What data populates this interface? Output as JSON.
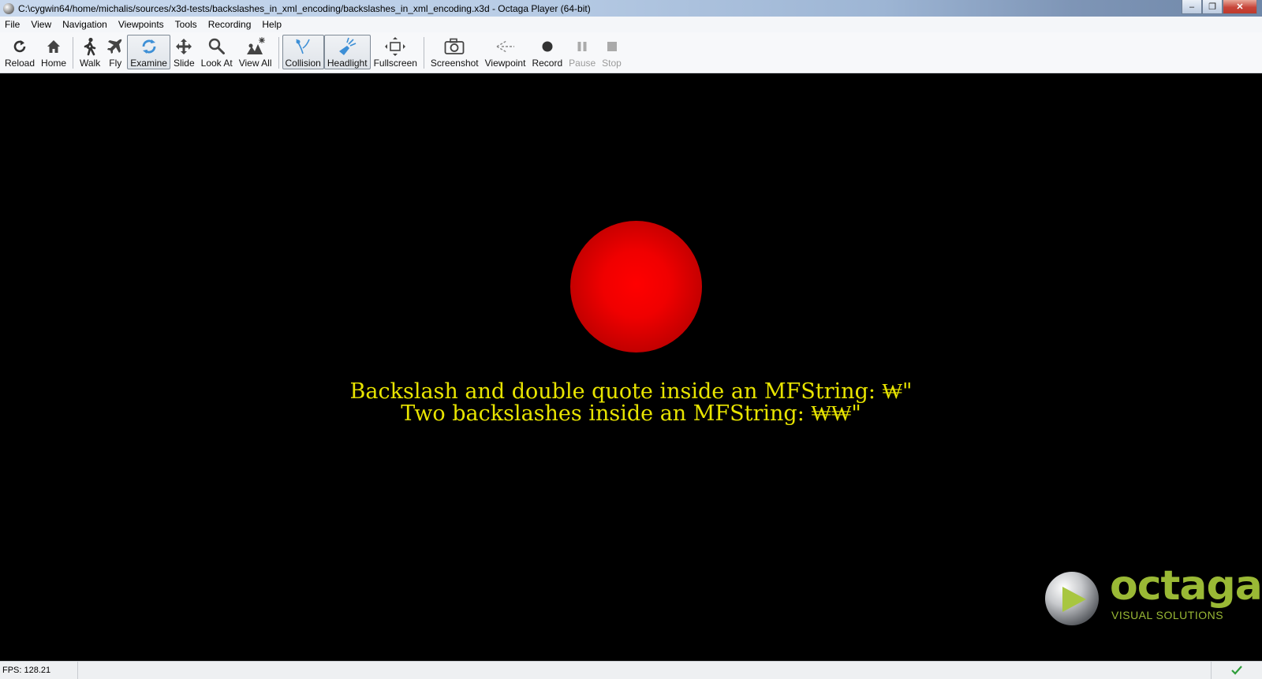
{
  "window": {
    "title": "C:\\cygwin64/home/michalis/sources/x3d-tests/backslashes_in_xml_encoding/backslashes_in_xml_encoding.x3d - Octaga Player (64-bit)",
    "minimize": "–",
    "restore": "❐",
    "close": "✕"
  },
  "menu": {
    "items": [
      "File",
      "View",
      "Navigation",
      "Viewpoints",
      "Tools",
      "Recording",
      "Help"
    ]
  },
  "toolbar": {
    "reload": "Reload",
    "home": "Home",
    "walk": "Walk",
    "fly": "Fly",
    "examine": "Examine",
    "slide": "Slide",
    "look_at": "Look At",
    "view_all": "View All",
    "collision": "Collision",
    "headlight": "Headlight",
    "fullscreen": "Fullscreen",
    "screenshot": "Screenshot",
    "viewpoint": "Viewpoint",
    "record": "Record",
    "pause": "Pause",
    "stop": "Stop"
  },
  "scene": {
    "line1": "Backslash and double quote inside an MFString: ₩\"",
    "line2": "Two backslashes inside an MFString: ₩₩\"",
    "text_color": "#e8e400",
    "sphere_color": "#ff0000"
  },
  "logo": {
    "word": "octaga",
    "tagline": "VISUAL SOLUTIONS",
    "color": "#9ab935"
  },
  "status": {
    "fps": "FPS: 128.21",
    "ok_icon": "checkmark-icon"
  }
}
